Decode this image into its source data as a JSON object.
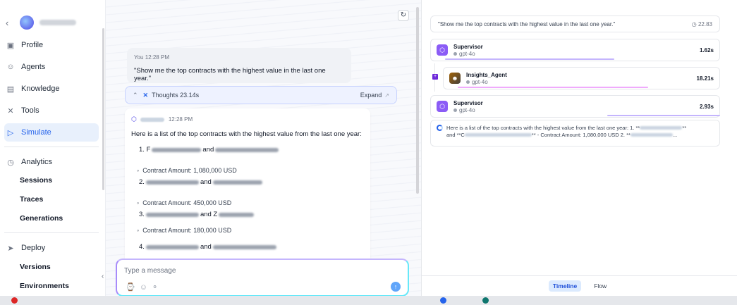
{
  "sidebar": {
    "nav": [
      {
        "label": "Profile",
        "icon": "profile-icon"
      },
      {
        "label": "Agents",
        "icon": "agents-icon"
      },
      {
        "label": "Knowledge",
        "icon": "knowledge-icon"
      },
      {
        "label": "Tools",
        "icon": "tools-icon"
      },
      {
        "label": "Simulate",
        "icon": "simulate-icon",
        "active": true
      }
    ],
    "analytics": {
      "label": "Analytics",
      "icon": "analytics-icon",
      "items": [
        "Sessions",
        "Traces",
        "Generations"
      ]
    },
    "deploy": {
      "label": "Deploy",
      "icon": "deploy-icon",
      "items": [
        "Versions",
        "Environments"
      ]
    }
  },
  "chat": {
    "user": {
      "name": "You",
      "time": "12:28 PM",
      "message": "\"Show me the top contracts with the highest value in the last one year.\""
    },
    "thoughts": {
      "label": "Thoughts 23.14s",
      "expand": "Expand"
    },
    "reply": {
      "time": "12:28 PM",
      "intro": "Here is a list of the top contracts with the highest value from the last one year:",
      "items": [
        {
          "num": "1.",
          "first_letter": "F",
          "and": "and",
          "amount": "Contract Amount: 1,080,000 USD"
        },
        {
          "num": "2.",
          "first_letter": "",
          "and": "and",
          "amount": "Contract Amount: 450,000 USD"
        },
        {
          "num": "3.",
          "first_letter": "",
          "and": "and Z",
          "amount": "Contract Amount: 180,000 USD"
        },
        {
          "num": "4.",
          "first_letter": "",
          "and": "and",
          "amount": ""
        }
      ]
    },
    "composer": {
      "placeholder": "Type a message"
    }
  },
  "trace": {
    "query": "\"Show me the top contracts with the highest value in the last one year.\"",
    "total_time": "22.83",
    "steps": [
      {
        "title": "Supervisor",
        "model": "gpt-4o",
        "duration": "1.62s"
      },
      {
        "title": "Insights_Agent",
        "model": "gpt-4o",
        "duration": "18.21s"
      },
      {
        "title": "Supervisor",
        "model": "gpt-4o",
        "duration": "2.93s"
      }
    ],
    "result_line1": "Here is a list of the top contracts with the highest value from the last one year: 1. **",
    "result_line2": "and **C",
    "result_line2b": "** - Contract Amount: 1,080,000 USD 2. **",
    "tabs": [
      "Timeline",
      "Flow"
    ],
    "colors": {
      "supervisor_bar": "#c4b5fd",
      "agent_bar": "#f0abfc"
    }
  }
}
